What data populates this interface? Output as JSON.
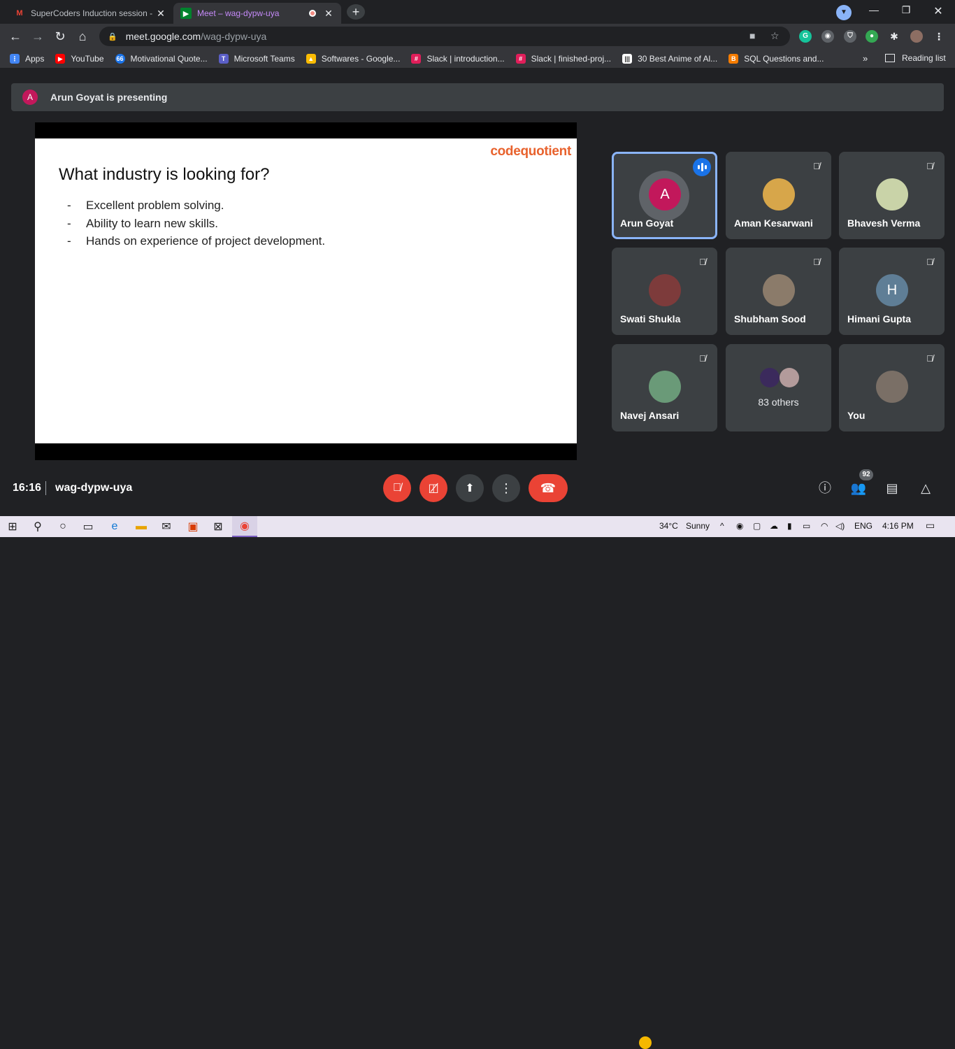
{
  "browser": {
    "tabs": [
      {
        "title": "SuperCoders Induction session -",
        "favicon": "gmail-icon",
        "active": false
      },
      {
        "title": "Meet – wag-dypw-uya",
        "favicon": "meet-icon",
        "active": true
      }
    ],
    "url": {
      "domain": "meet.google.com",
      "path": "/wag-dypw-uya"
    },
    "bookmarks": [
      {
        "label": "Apps",
        "icon": "apps-grid-icon",
        "color": "#4285f4"
      },
      {
        "label": "YouTube",
        "icon": "youtube-icon",
        "color": "#ff0000"
      },
      {
        "label": "Motivational Quote...",
        "icon": "quote-icon",
        "color": "#1a73e8"
      },
      {
        "label": "Microsoft Teams",
        "icon": "teams-icon",
        "color": "#5b5fc7"
      },
      {
        "label": "Softwares - Google...",
        "icon": "drive-icon",
        "color": "#fbbc04"
      },
      {
        "label": "Slack | introduction...",
        "icon": "slack-icon",
        "color": "#e01e5a"
      },
      {
        "label": "Slack | finished-proj...",
        "icon": "slack-icon",
        "color": "#e01e5a"
      },
      {
        "label": "30 Best Anime of Al...",
        "icon": "anime-icon",
        "color": "#ffffff"
      },
      {
        "label": "SQL Questions and...",
        "icon": "blogger-icon",
        "color": "#f57c00"
      }
    ],
    "more_bookmarks": "»",
    "reading_list": "Reading list"
  },
  "meet": {
    "presenter_banner": {
      "initial": "A",
      "text": "Arun Goyat is presenting"
    },
    "slide": {
      "brand": "codequotient",
      "title": "What industry is looking for?",
      "bullets": [
        "Excellent problem solving.",
        "Ability to learn new skills.",
        "Hands on experience of project development."
      ]
    },
    "participants": [
      {
        "name": "Arun Goyat",
        "initial": "A",
        "color": "#c2185b",
        "speaking": true
      },
      {
        "name": "Aman Kesarwani",
        "color": "#d7a64a",
        "muted": true
      },
      {
        "name": "Bhavesh Verma",
        "color": "#c9d3a8",
        "muted": true
      },
      {
        "name": "Swati Shukla",
        "color": "#7d3b3b",
        "muted": true
      },
      {
        "name": "Shubham Sood",
        "color": "#8b7b6a",
        "muted": true
      },
      {
        "name": "Himani Gupta",
        "initial": "H",
        "color": "#5f7e96",
        "muted": true
      },
      {
        "name": "Navej Ansari",
        "color": "#6a9a78",
        "muted": true
      },
      {
        "others": "83 others"
      },
      {
        "name": "You",
        "color": "#7a6f66",
        "muted": true
      }
    ],
    "time": "16:16",
    "meeting_code": "wag-dypw-uya",
    "people_count": "92"
  },
  "taskbar": {
    "weather_temp": "34°C",
    "weather_text": "Sunny",
    "language": "ENG",
    "time": "4:16 PM"
  }
}
